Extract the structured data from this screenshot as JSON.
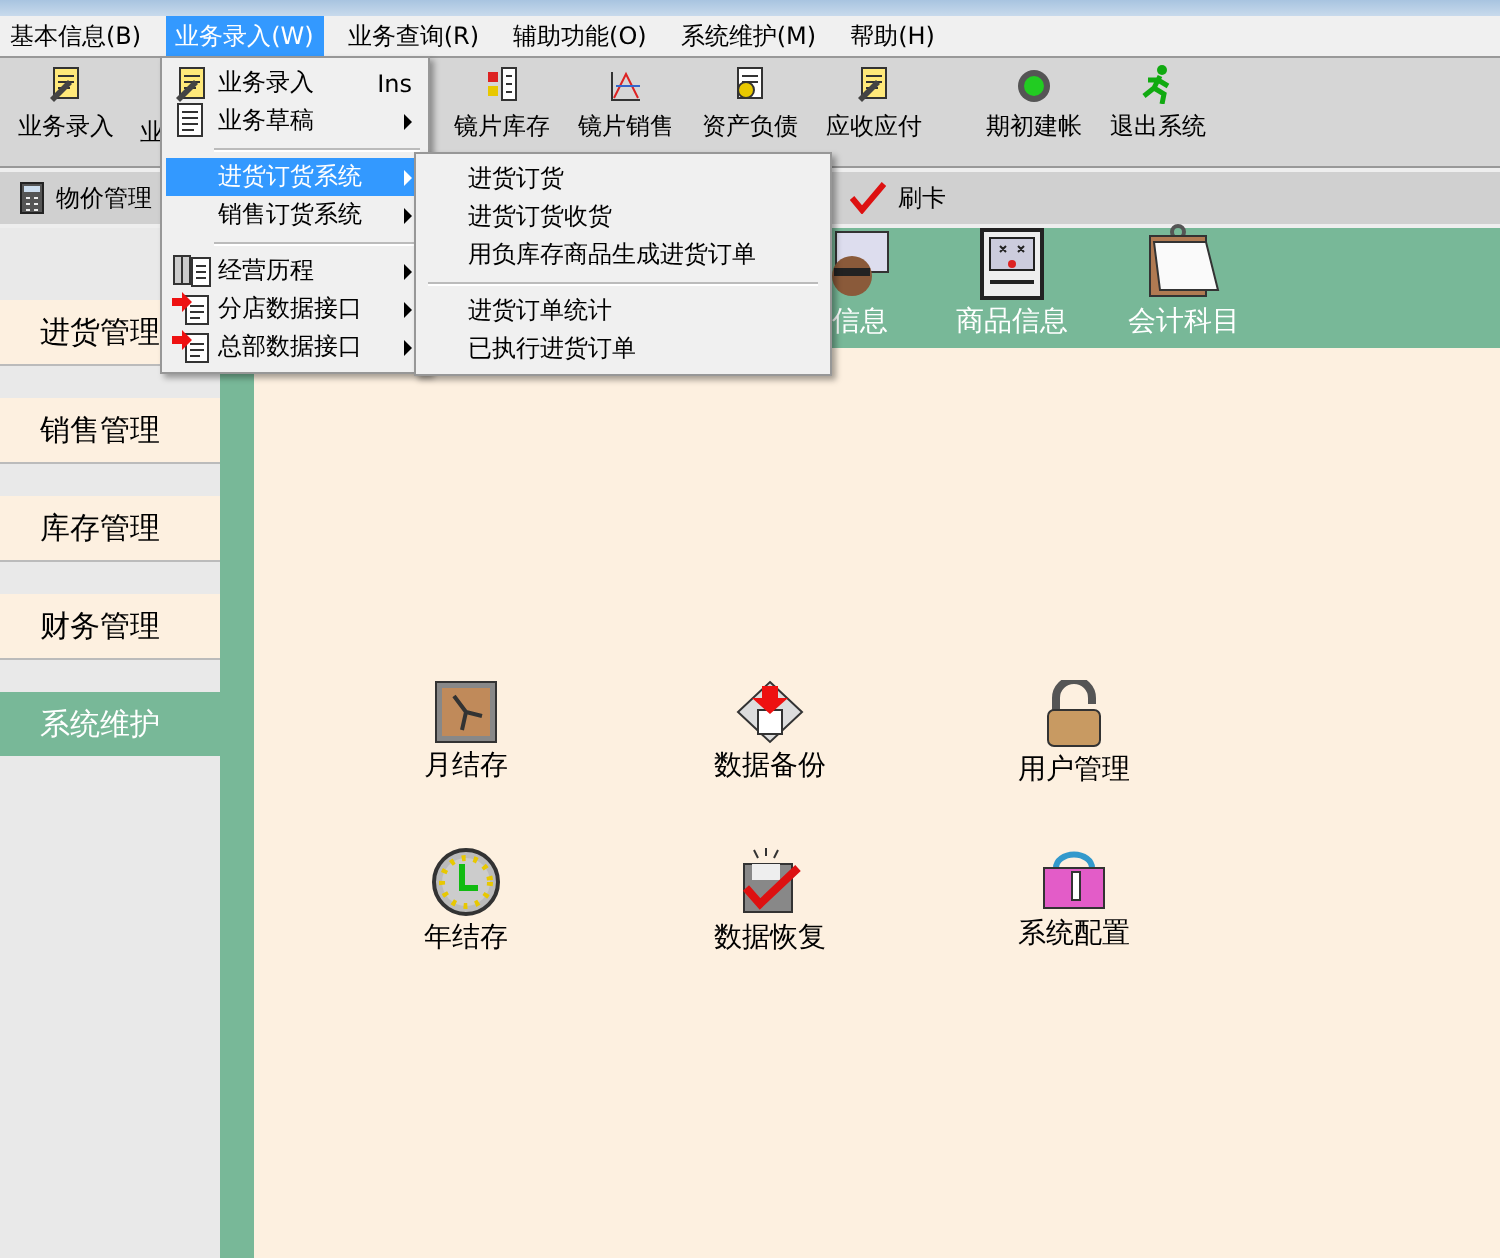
{
  "menubar": [
    {
      "label": "基本信息(B)",
      "selected": false
    },
    {
      "label": "业务录入(W)",
      "selected": true
    },
    {
      "label": "业务查询(R)",
      "selected": false
    },
    {
      "label": "辅助功能(O)",
      "selected": false
    },
    {
      "label": "系统维护(M)",
      "selected": false
    },
    {
      "label": "帮助(H)",
      "selected": false
    }
  ],
  "toolbar": {
    "buttons": [
      "业务录入",
      "业"
    ],
    "more_buttons": [
      "镜片库存",
      "镜片销售",
      "资产负债",
      "应收应付"
    ],
    "extra_buttons": [
      "期初建帐",
      "退出系统"
    ]
  },
  "quickbar": [
    "物价管理",
    "刷卡"
  ],
  "sidebar": {
    "items": [
      {
        "label": "进货管理",
        "selected": false
      },
      {
        "label": "销售管理",
        "selected": false
      },
      {
        "label": "库存管理",
        "selected": false
      },
      {
        "label": "财务管理",
        "selected": false
      },
      {
        "label": "系统维护",
        "selected": true
      }
    ]
  },
  "band": [
    "信息",
    "商品信息",
    "会计科目"
  ],
  "tools": [
    "月结存",
    "数据备份",
    "用户管理",
    "年结存",
    "数据恢复",
    "系统配置"
  ],
  "menu": {
    "items": [
      {
        "kind": "item",
        "label": "业务录入",
        "shortcut": "Ins",
        "submenu": false,
        "selected": false
      },
      {
        "kind": "item",
        "label": "业务草稿",
        "submenu": true,
        "selected": false
      },
      {
        "kind": "separator"
      },
      {
        "kind": "item",
        "label": "进货订货系统",
        "submenu": true,
        "selected": true
      },
      {
        "kind": "item",
        "label": "销售订货系统",
        "submenu": true,
        "selected": false
      },
      {
        "kind": "separator"
      },
      {
        "kind": "item",
        "label": "经营历程",
        "submenu": true,
        "selected": false
      },
      {
        "kind": "item",
        "label": "分店数据接口",
        "submenu": true,
        "selected": false
      },
      {
        "kind": "item",
        "label": "总部数据接口",
        "submenu": true,
        "selected": false
      }
    ]
  },
  "submenu": {
    "items": [
      {
        "kind": "item",
        "label": "进货订货"
      },
      {
        "kind": "item",
        "label": "进货订货收货"
      },
      {
        "kind": "item",
        "label": "用负库存商品生成进货订单"
      },
      {
        "kind": "separator"
      },
      {
        "kind": "item",
        "label": "进货订单统计"
      },
      {
        "kind": "item",
        "label": "已执行进货订单"
      }
    ]
  }
}
